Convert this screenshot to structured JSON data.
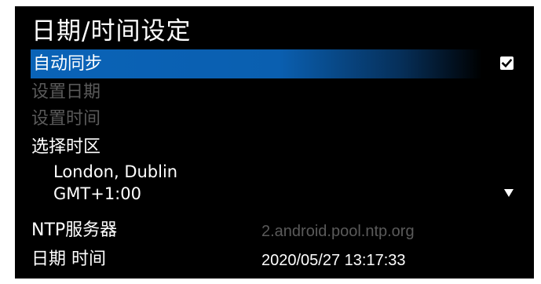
{
  "screen": {
    "title": "日期/时间设定"
  },
  "menu": {
    "auto_sync": {
      "label": "自动同步",
      "checked": true
    },
    "set_date": {
      "label": "设置日期"
    },
    "set_time": {
      "label": "设置时间"
    },
    "time_zone": {
      "label": "选择时区",
      "city": "London, Dublin",
      "offset": "GMT+1:00"
    },
    "ntp_server": {
      "label": "NTP服务器",
      "value": "2.android.pool.ntp.org"
    },
    "date_time": {
      "label": "日期 时间",
      "value": "2020/05/27 13:17:33"
    }
  },
  "icons": {
    "checkbox": "checkbox-checked-icon",
    "dropdown": "dropdown-arrow-icon"
  },
  "colors": {
    "background": "#000000",
    "highlight": "#0a63b7",
    "text": "#ffffff",
    "disabled_text": "#5a5a5a"
  }
}
